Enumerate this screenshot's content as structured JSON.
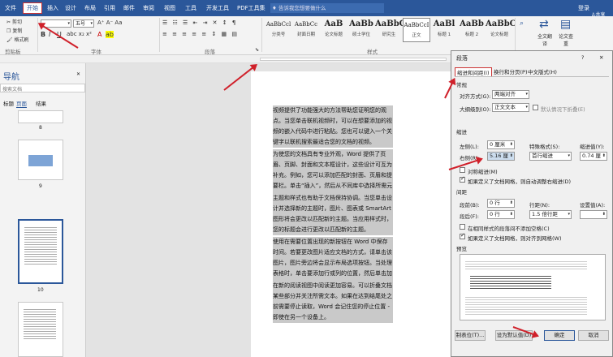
{
  "menubar": {
    "tabs": [
      "文件",
      "开始",
      "插入",
      "设计",
      "布局",
      "引用",
      "邮件",
      "审阅",
      "视图",
      "工具",
      "开发工具",
      "PDF工具集"
    ],
    "search_placeholder": "告诉我您想要做什么",
    "login": "登录",
    "share": "共享"
  },
  "ribbon": {
    "cut": "剪切",
    "copy": "复制",
    "format_painter": "格式刷",
    "paste": "粘贴",
    "clipboard_label": "剪贴板",
    "font_label": "字体",
    "paragraph_label": "段落",
    "styles_label": "样式",
    "font_size": "五号",
    "styles": [
      {
        "preview": "AaBbCcl",
        "name": "分类号"
      },
      {
        "preview": "AaBbCc",
        "name": "封面日期"
      },
      {
        "preview": "AaB",
        "name": "论文标题"
      },
      {
        "preview": "AaBb",
        "name": "硕士学位"
      },
      {
        "preview": "AaBbC",
        "name": "研究生"
      },
      {
        "preview": "AaBbCcI",
        "name": "正文"
      },
      {
        "preview": "AaBl",
        "name": "标题 1"
      },
      {
        "preview": "AaBb",
        "name": "标题 2"
      },
      {
        "preview": "AaBbC",
        "name": "论文标题"
      }
    ],
    "translate": "全文翻译",
    "check": "论文查重"
  },
  "nav": {
    "title": "导航",
    "search_placeholder": "搜索文档",
    "tabs": [
      "标题",
      "页面",
      "结果"
    ],
    "page_numbers": [
      "8",
      "9",
      "10"
    ]
  },
  "document": {
    "paragraphs": [
      "视频提供了功能强大的方法帮助您证明您的观点。当您单击联机视频时，可以在想要添加的视频的嵌入代码中进行粘贴。您也可以键入一个关键字以联机搜索最适合您的文档的视频。",
      "为使您的文档具有专业外观，Word 提供了页眉、页脚、封面和文本框设计，这些设计可互为补充。例如，您可以添加匹配的封面、页眉和提要栏。单击“插入”，然后从不同库中选择所需元素。",
      "主题和样式也有助于文档保持协调。当您单击设计并选择新的主题时，图片、图表或 SmartArt 图形将会更改以匹配新的主题。当应用样式时，您的标题会进行更改以匹配新的主题。",
      "使用在需要位置出现的新按钮在 Word 中保存时间。若要更改图片适应文档的方式，请单击该图片，图片旁边将会显示布局选项按钮。当处理表格时，单击要添加行或列的位置，然后单击加号。",
      "在新的阅读视图中阅读更加容易。可以折叠文档某些部分并关注所需文本。如果在达到结尾处之前需要停止读取，Word 会记住您的停止位置 - 即使在另一个设备上。"
    ]
  },
  "dialog": {
    "title": "段落",
    "help": "?",
    "close": "✕",
    "tabs": [
      "缩进和间距(I)",
      "换行和分页(P)",
      "中文版式(H)"
    ],
    "general": "常规",
    "alignment_label": "对齐方式(G):",
    "alignment_value": "两端对齐",
    "outline_label": "大纲级别(O):",
    "outline_value": "正文文本",
    "collapsed_label": "默认情况下折叠(E)",
    "indent": "缩进",
    "left_label": "左侧(L):",
    "left_value": "0 厘米",
    "right_label": "右侧(R):",
    "right_value": "5.16 厘",
    "special_label": "特殊格式(S):",
    "special_value": "首行缩进",
    "indent_by_label": "缩进值(Y):",
    "indent_by_value": "0.74 厘",
    "mirror_label": "对称缩进(M)",
    "auto_right_label": "如果定义了文档网格，则自动调整右缩进(D)",
    "spacing": "间距",
    "before_label": "段前(B):",
    "before_value": "0 行",
    "after_label": "段后(F):",
    "after_value": "0 行",
    "line_spacing_label": "行距(N):",
    "line_spacing_value": "1.5 倍行距",
    "at_label": "设置值(A):",
    "no_space_label": "在相同样式的段落间不添加空格(C)",
    "snap_grid_label": "如果定义了文档网格，则对齐到网格(W)",
    "preview": "预览",
    "tabs_button": "制表位(T)...",
    "default_button": "设为默认值(D)",
    "ok_button": "确定",
    "cancel_button": "取消"
  }
}
